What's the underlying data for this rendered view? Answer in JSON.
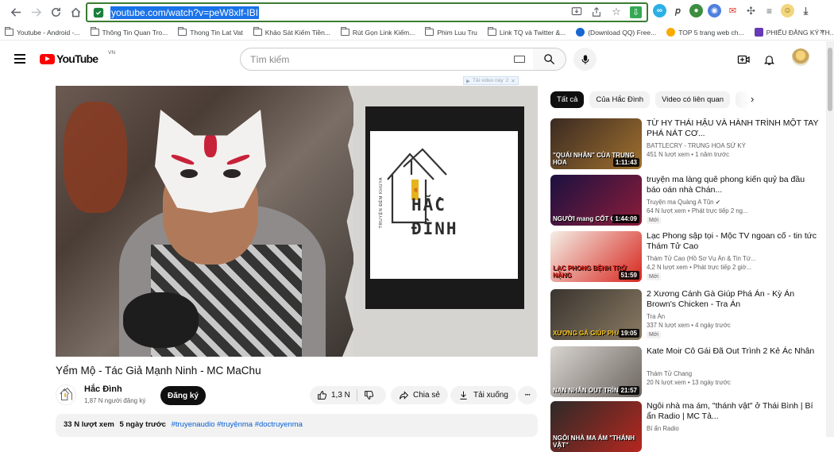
{
  "browser": {
    "url": "youtube.com/watch?v=peW8xlf-IBI",
    "bookmarks": [
      "Youtube - Android -...",
      "Thông Tin Quan Tro...",
      "Thong Tin Lat Vat",
      "Khảo Sát Kiếm Tiền...",
      "Rút Gọn Link Kiếm...",
      "Phim Luu Tru",
      "Link TQ và Twitter &...",
      "(Download QQ) Free...",
      "TOP 5 trang web ch...",
      "PHIẾU ĐĂNG KÝ TH..."
    ],
    "more_label": "»"
  },
  "header": {
    "logo_text": "YouTube",
    "region": "VN",
    "search_placeholder": "Tìm kiếm"
  },
  "video": {
    "ad_label": "Tải video này",
    "ad_badge": "2",
    "logo_lines": [
      "HẮC",
      "ĐÌNH"
    ],
    "logo_vertical": "TRUYỆN ĐÊM KHUYA",
    "title": "Yểm Mộ - Tác Giả Mạnh Ninh - MC MaChu",
    "channel": "Hắc Đình",
    "subscribers": "1,87 N người đăng ký",
    "subscribe_label": "Đăng ký",
    "likes": "1,3 N",
    "share_label": "Chia sẻ",
    "download_label": "Tải xuống",
    "more_label": "···",
    "views": "33 N lượt xem",
    "age": "5 ngày trước",
    "tags": "#truyenaudio #truyệnma #doctruyenma"
  },
  "sidebar": {
    "chips": [
      "Tất cả",
      "Của Hắc Đình",
      "Video có liên quan"
    ],
    "next_label": "›",
    "recommendations": [
      {
        "title": "TỪ HY THÁI HẬU VÀ HÀNH TRÌNH MỘT TAY PHÁ NÁT CƠ...",
        "channel": "BATTLECRY - TRUNG HOA SỬ KÝ",
        "meta": "451 N lượt xem • 1 năm trước",
        "duration": "1:11:43",
        "thumb_caption": "\"QUÁI NHÂN\" CỦA TRUNG HOA",
        "badge": "",
        "colors": [
          "#3a2a22",
          "#a0702e"
        ]
      },
      {
        "title": "truyện ma làng quê phong kiến quỷ ba đầu báo oán nhà Chán...",
        "channel": "Truyện ma Quàng A Tũn ✔",
        "meta": "64 N lượt xem • Phát trực tiếp 2 ng...",
        "duration": "1:44:09",
        "thumb_caption": "NGƯỜI mang CỐT QUỶ",
        "badge": "Mới",
        "colors": [
          "#1b1140",
          "#8c1d3a"
        ]
      },
      {
        "title": "Lạc Phong sập tọi - Mộc TV ngoan cố - tin tức Thám Tử Cao",
        "channel": "Thám Tử Cao (Hồ Sơ Vụ Án & Tin Tứ...",
        "meta": "4,2 N lượt xem • Phát trực tiếp 2 giờ...",
        "duration": "51:59",
        "thumb_caption": "LẠC PHONG BỆNH TRỞ NẶNG",
        "badge": "Mới",
        "colors": [
          "#f4efe6",
          "#d7261e"
        ]
      },
      {
        "title": "2 Xương Cánh Gà Giúp Phá Án - Kỳ Án Brown's Chicken - Tra Án",
        "channel": "Tra Án",
        "meta": "337 N lượt xem • 4 ngày trước",
        "duration": "19:05",
        "thumb_caption": "XƯƠNG GÀ GIÚP PHÁ ÁN",
        "badge": "Mới",
        "colors": [
          "#3a3530",
          "#8a7a62"
        ]
      },
      {
        "title": "Kate Moir Cô Gái Đã Out Trình 2 Kẻ Ác Nhân",
        "channel": "Thám Tử Chang",
        "meta": "20 N lượt xem • 13 ngày trước",
        "duration": "21:57",
        "thumb_caption": "NẠN NHÂN OUT TRÌNH",
        "badge": "",
        "colors": [
          "#d8d4cf",
          "#6c6560"
        ]
      },
      {
        "title": "Ngôi nhà ma ám, \"thánh vật\" ở Thái Bình | Bí ẩn Radio | MC Tả...",
        "channel": "Bí ẩn Radio",
        "meta": "",
        "duration": "",
        "thumb_caption": "NGÔI NHÀ MA ÁM \"THÁNH VẬT\"",
        "badge": "",
        "colors": [
          "#2d2a28",
          "#b5271f"
        ]
      }
    ]
  }
}
